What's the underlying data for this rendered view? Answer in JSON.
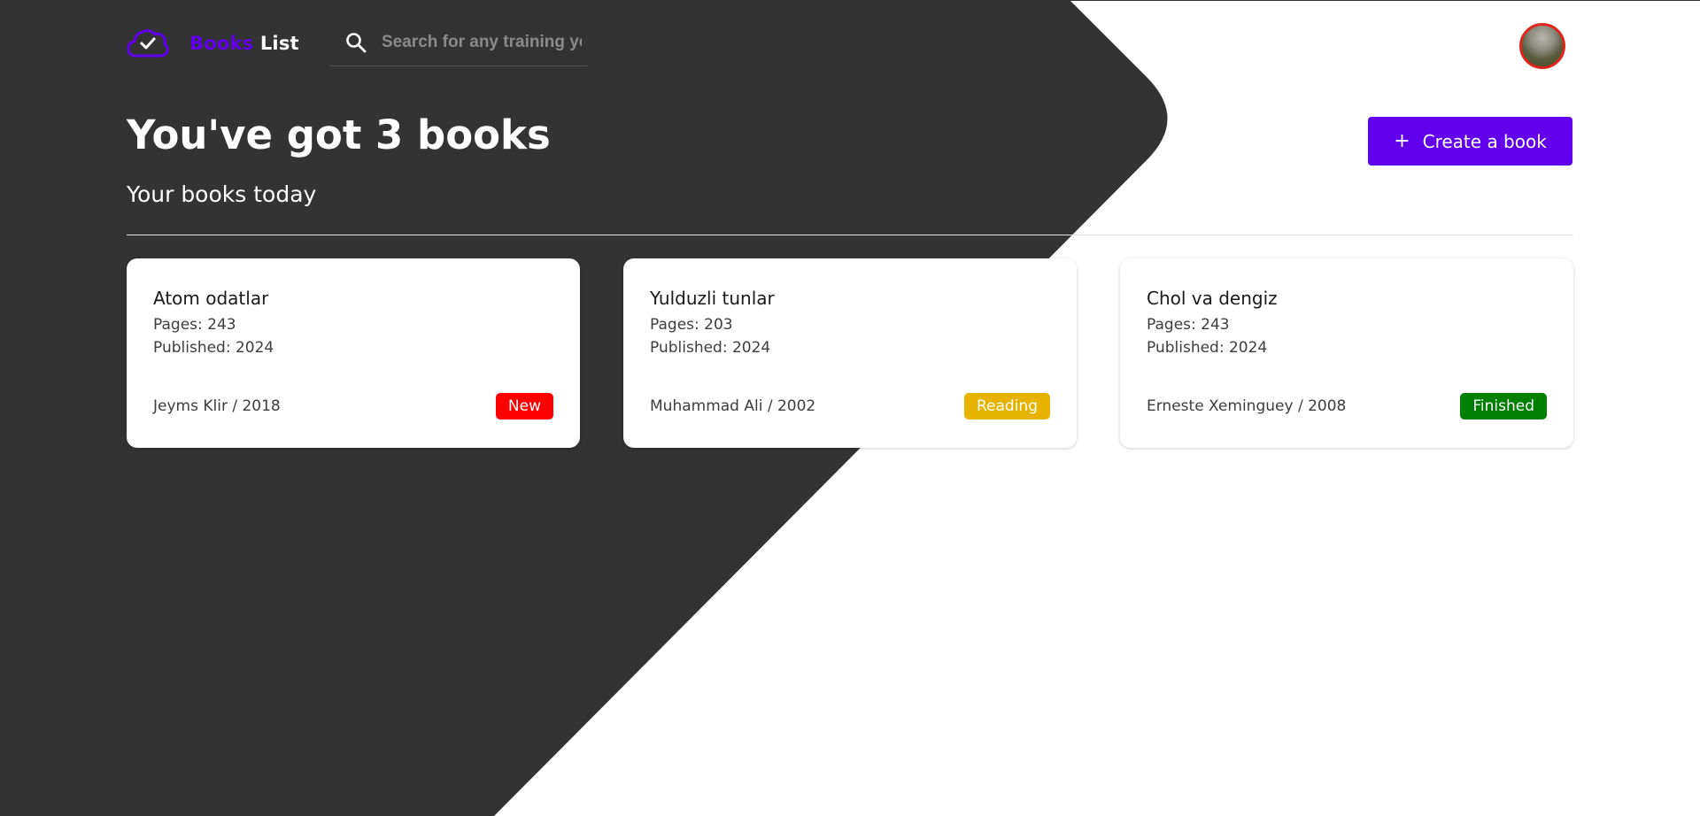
{
  "header": {
    "logo_word_1": "Books",
    "logo_word_2": "List",
    "search_placeholder": "Search for any training you want",
    "search_value": ""
  },
  "main": {
    "title": "You've got 3 books",
    "subtitle": "Your books today",
    "create_button": {
      "icon": "+",
      "label": "Create a book"
    }
  },
  "books": [
    {
      "title": "Atom odatlar",
      "pages": "Pages: 243",
      "published": "Published: 2024",
      "author": "Jeyms Klir / 2018",
      "status": "New",
      "status_color": "#ff0000"
    },
    {
      "title": "Yulduzli tunlar",
      "pages": "Pages: 203",
      "published": "Published: 2024",
      "author": "Muhammad Ali / 2002",
      "status": "Reading",
      "status_color": "#e6b400"
    },
    {
      "title": "Chol va dengiz",
      "pages": "Pages: 243",
      "published": "Published: 2024",
      "author": "Erneste Xeminguey / 2008",
      "status": "Finished",
      "status_color": "#008000"
    }
  ],
  "colors": {
    "accent": "#6200ee",
    "dark_background": "#333333",
    "avatar_border": "#e0241b"
  },
  "icons": {
    "logo": "cloud-check-icon",
    "search": "search-icon",
    "create": "plus-icon"
  }
}
